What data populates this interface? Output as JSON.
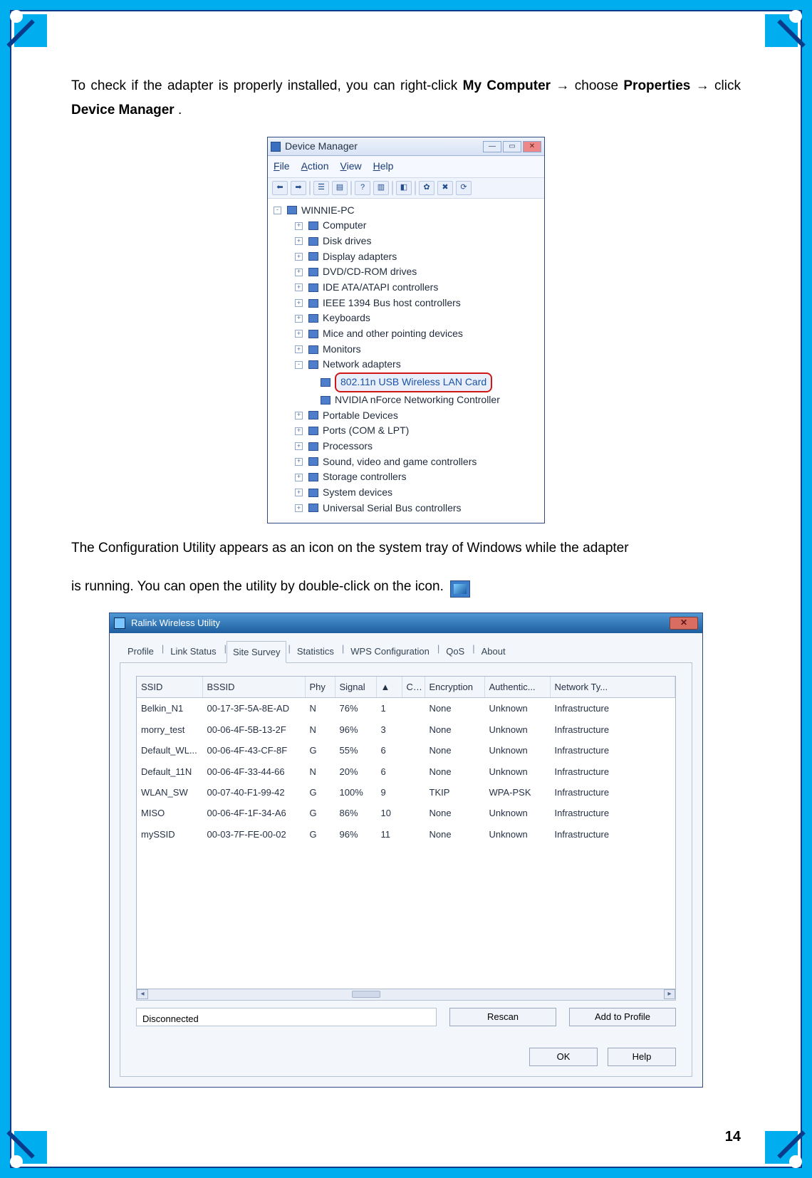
{
  "page_number": "14",
  "intro": {
    "p1_pre": "To check if the adapter is properly installed, you can right-click ",
    "p1_b1": "My Computer",
    "arrow": " → ",
    "p1_mid": " choose ",
    "p1_b2": "Properties",
    "p1_mid2": " click ",
    "p1_b3": "Device Manager",
    "p1_end": "."
  },
  "device_manager": {
    "title": "Device Manager",
    "menu": [
      "File",
      "Action",
      "View",
      "Help"
    ],
    "root": "WINNIE-PC",
    "items": [
      "Computer",
      "Disk drives",
      "Display adapters",
      "DVD/CD-ROM drives",
      "IDE ATA/ATAPI controllers",
      "IEEE 1394 Bus host controllers",
      "Keyboards",
      "Mice and other pointing devices",
      "Monitors"
    ],
    "network_adapters": {
      "label": "Network adapters",
      "children": [
        "802.11n USB Wireless LAN Card",
        "NVIDIA nForce Networking Controller"
      ]
    },
    "items_after": [
      "Portable Devices",
      "Ports (COM & LPT)",
      "Processors",
      "Sound, video and game controllers",
      "Storage controllers",
      "System devices",
      "Universal Serial Bus controllers"
    ]
  },
  "mid_text": {
    "p1": "The Configuration Utility appears as an icon on the system tray of Windows while the adapter",
    "p2": "is running. You can open the utility by double-click on the icon."
  },
  "ralink": {
    "title": "Ralink Wireless Utility",
    "tabs": [
      "Profile",
      "Link Status",
      "Site Survey",
      "Statistics",
      "WPS Configuration",
      "QoS",
      "About"
    ],
    "active_tab": "Site Survey",
    "columns": [
      "SSID",
      "BSSID",
      "Phy",
      "Signal",
      "▲",
      "C...",
      "Encryption",
      "Authentic...",
      "Network Ty..."
    ],
    "rows": [
      {
        "ssid": "Belkin_N1",
        "bssid": "00-17-3F-5A-8E-AD",
        "phy": "N",
        "signal": "76%",
        "ch": "1",
        "c": "",
        "enc": "None",
        "auth": "Unknown",
        "net": "Infrastructure"
      },
      {
        "ssid": "morry_test",
        "bssid": "00-06-4F-5B-13-2F",
        "phy": "N",
        "signal": "96%",
        "ch": "3",
        "c": "",
        "enc": "None",
        "auth": "Unknown",
        "net": "Infrastructure"
      },
      {
        "ssid": "Default_WL...",
        "bssid": "00-06-4F-43-CF-8F",
        "phy": "G",
        "signal": "55%",
        "ch": "6",
        "c": "",
        "enc": "None",
        "auth": "Unknown",
        "net": "Infrastructure"
      },
      {
        "ssid": "Default_11N",
        "bssid": "00-06-4F-33-44-66",
        "phy": "N",
        "signal": "20%",
        "ch": "6",
        "c": "",
        "enc": "None",
        "auth": "Unknown",
        "net": "Infrastructure"
      },
      {
        "ssid": "WLAN_SW",
        "bssid": "00-07-40-F1-99-42",
        "phy": "G",
        "signal": "100%",
        "ch": "9",
        "c": "",
        "enc": "TKIP",
        "auth": "WPA-PSK",
        "net": "Infrastructure"
      },
      {
        "ssid": "MISO",
        "bssid": "00-06-4F-1F-34-A6",
        "phy": "G",
        "signal": "86%",
        "ch": "10",
        "c": "",
        "enc": "None",
        "auth": "Unknown",
        "net": "Infrastructure"
      },
      {
        "ssid": "mySSID",
        "bssid": "00-03-7F-FE-00-02",
        "phy": "G",
        "signal": "96%",
        "ch": "11",
        "c": "",
        "enc": "None",
        "auth": "Unknown",
        "net": "Infrastructure"
      }
    ],
    "status": "Disconnected",
    "buttons": {
      "rescan": "Rescan",
      "add": "Add to Profile",
      "ok": "OK",
      "help": "Help"
    }
  }
}
